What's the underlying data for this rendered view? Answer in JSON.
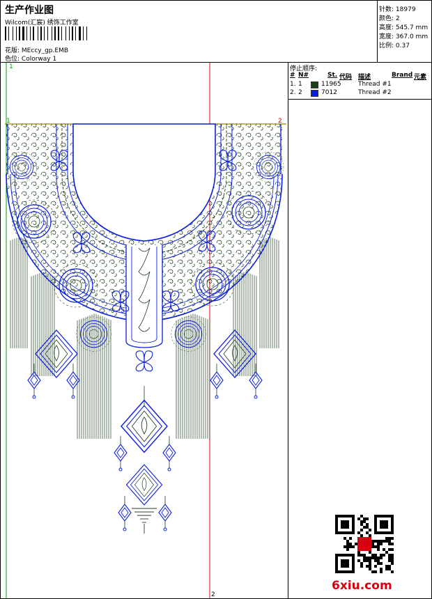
{
  "header": {
    "title": "生产作业图",
    "studio": "Wilcom(汇宸) 绣饰工作室",
    "design_label": "花版:",
    "design_value": "MEccy_gp.EMB",
    "colorway_label": "色位:",
    "colorway_value": "Colorway 1"
  },
  "stats": [
    {
      "label": "针数:",
      "value": "18979"
    },
    {
      "label": "颜色:",
      "value": "2"
    },
    {
      "label": "高度:",
      "value": "545.7 mm"
    },
    {
      "label": "宽度:",
      "value": "367.0 mm"
    },
    {
      "label": "比例:",
      "value": "0.37"
    }
  ],
  "sequence": {
    "heading": "停止顺序:",
    "columns": [
      "#",
      "N#",
      "St.",
      "代码",
      "描述",
      "Brand",
      "元素"
    ],
    "rows": [
      {
        "num": "1.",
        "needle": "1",
        "code": "11965",
        "desc": "Thread #1",
        "color": "#1c3f1c"
      },
      {
        "num": "2.",
        "needle": "2",
        "code": "7012",
        "desc": "Thread #2",
        "color": "#0a1ee0"
      }
    ]
  },
  "canvas": {
    "marker_tl": "1",
    "marker_mid_left": "1",
    "marker_mid_right": "2",
    "marker_bottom": "2"
  },
  "colors": {
    "thread1": "#1c3f1c",
    "thread2": "#0a1ee0",
    "guide_green": "#00a000",
    "guide_red": "#e00000",
    "guide_olive": "#9a8a00"
  },
  "icons": {
    "qr": "qr-code-icon",
    "logo": "watermark-logo"
  },
  "watermark": "6xiu.com"
}
